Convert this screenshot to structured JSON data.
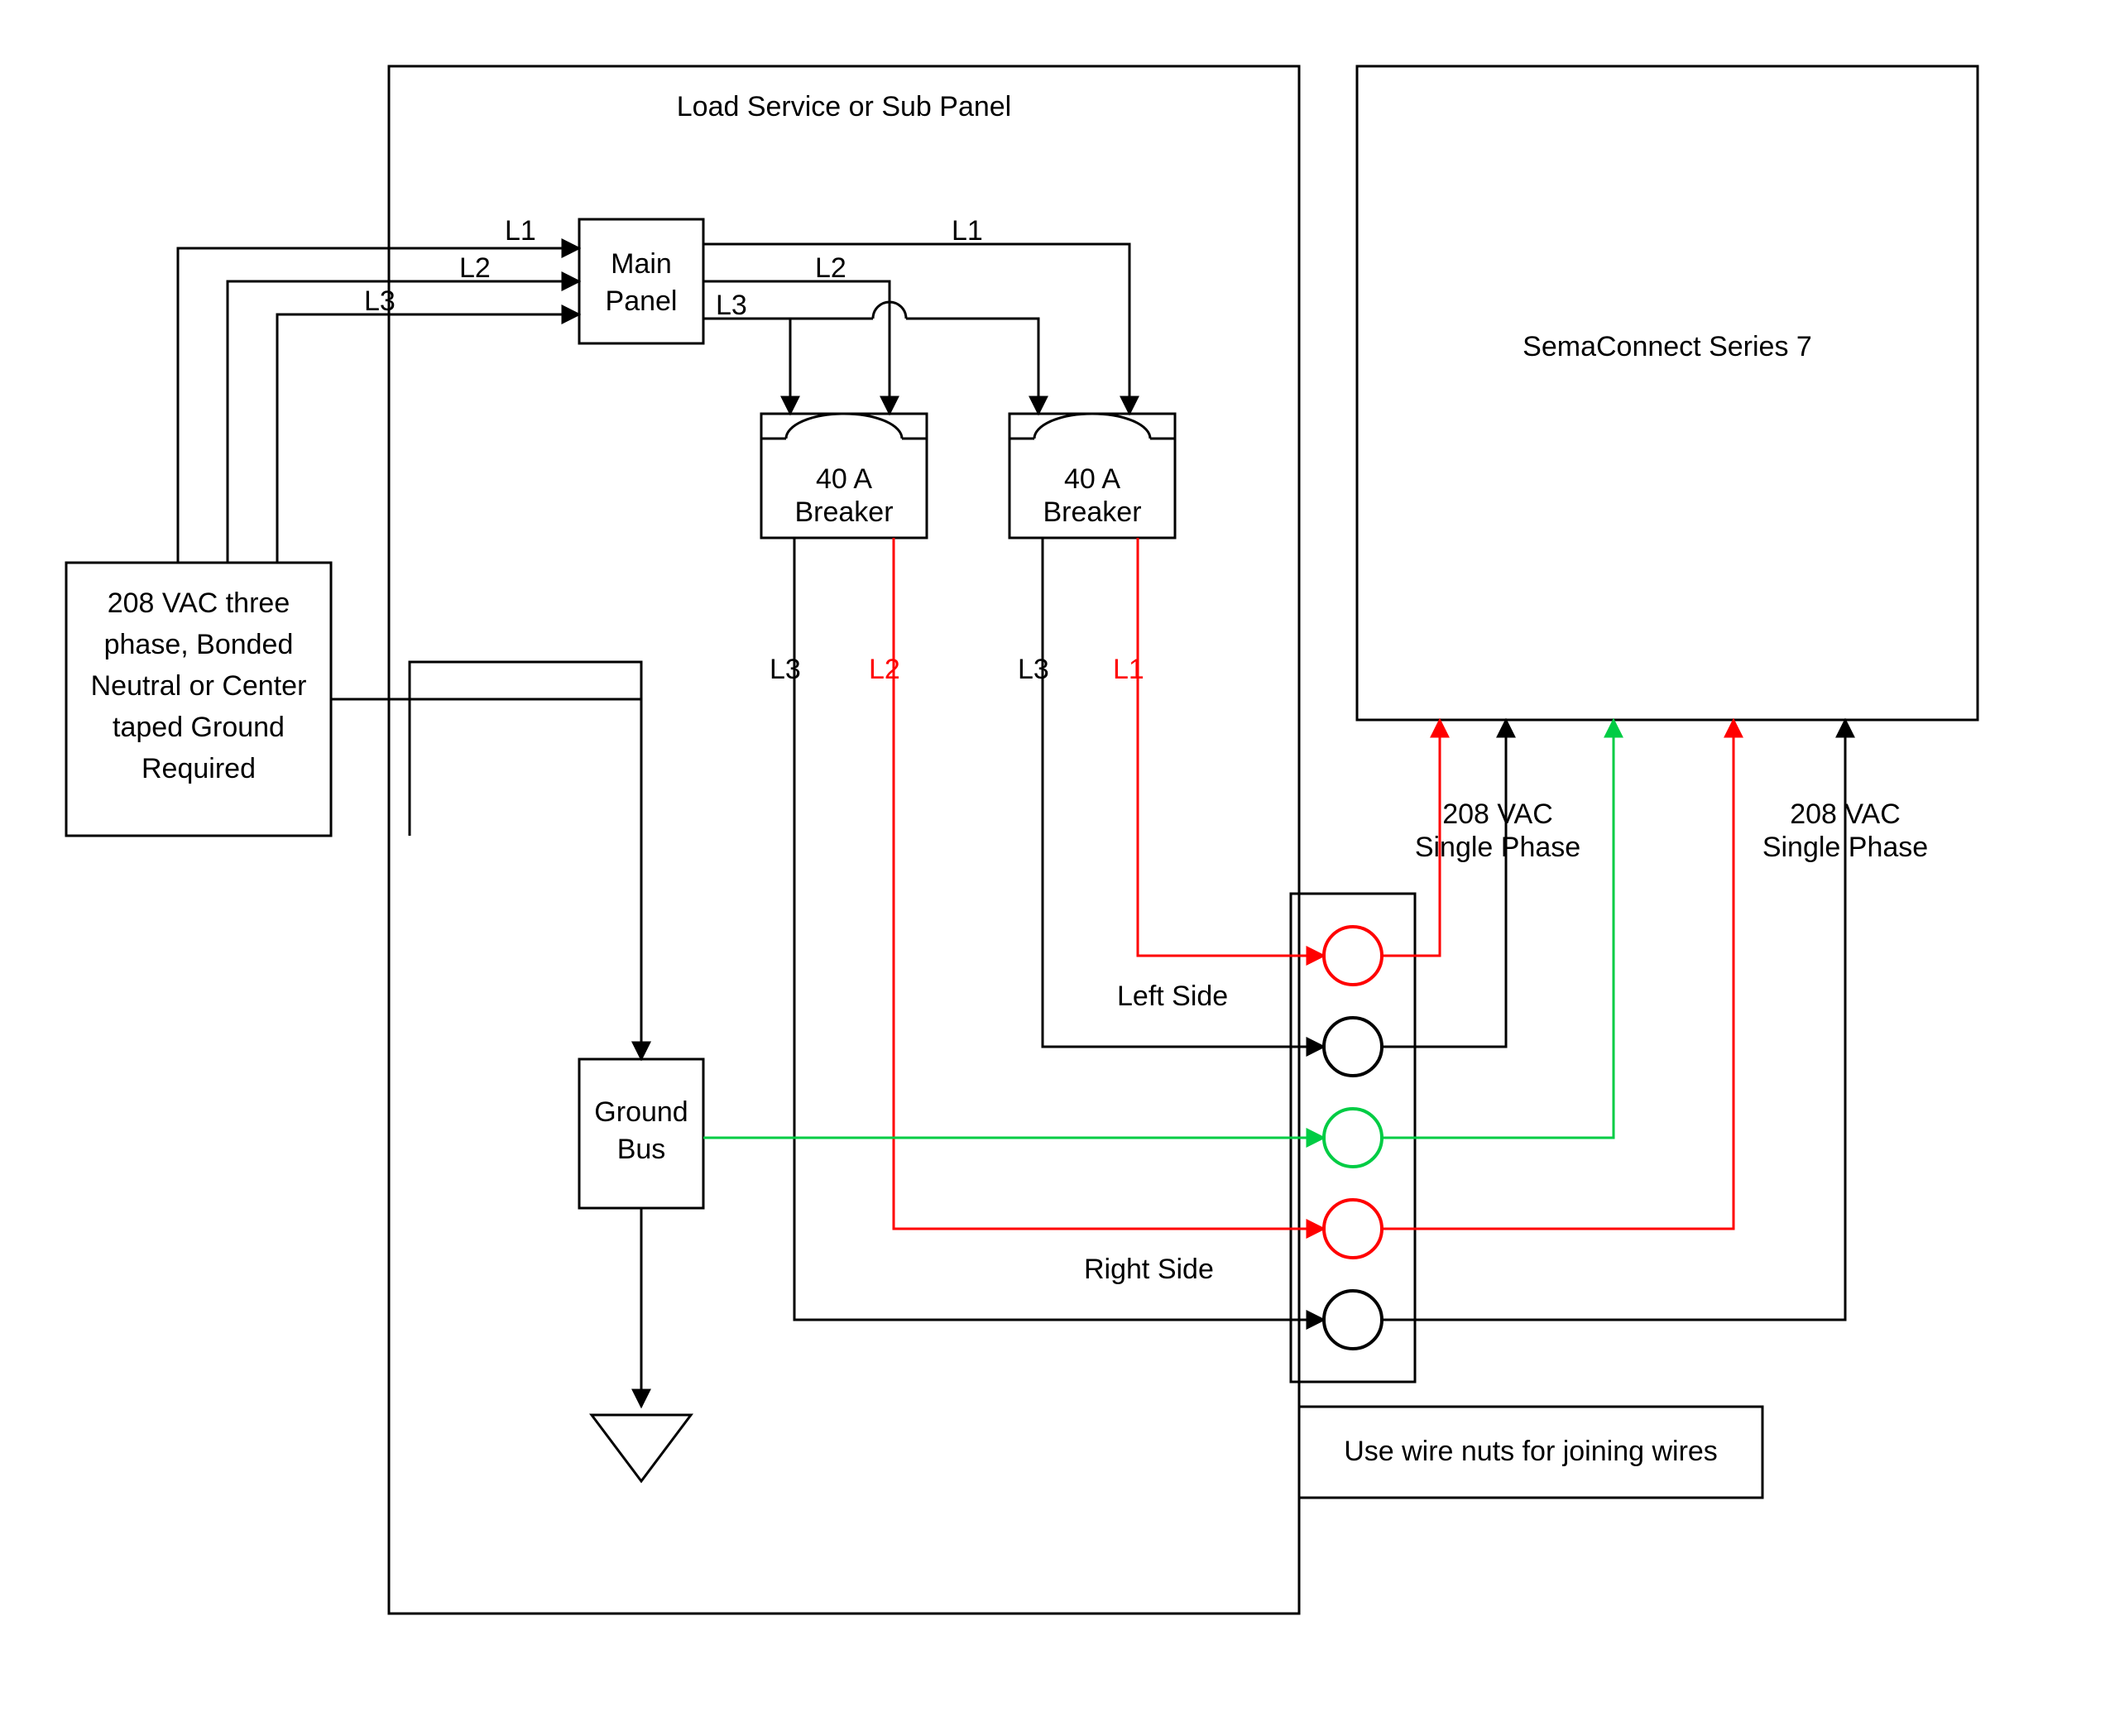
{
  "diagram": {
    "panel_title": "Load Service or Sub Panel",
    "source_box": {
      "l1": "208 VAC three",
      "l2": "phase, Bonded",
      "l3": "Neutral or Center",
      "l4": "taped Ground",
      "l5": "Required"
    },
    "main_panel": {
      "l1": "Main",
      "l2": "Panel"
    },
    "phases": {
      "l1": "L1",
      "l2": "L2",
      "l3": "L3"
    },
    "breaker1": {
      "l1": "40 A",
      "l2": "Breaker"
    },
    "breaker2": {
      "l1": "40 A",
      "l2": "Breaker"
    },
    "breaker1_out": {
      "left": "L3",
      "right": "L2"
    },
    "breaker2_out": {
      "left": "L3",
      "right": "L1"
    },
    "ground_bus": {
      "l1": "Ground",
      "l2": "Bus"
    },
    "left_side": "Left Side",
    "right_side": "Right Side",
    "phase_label1": {
      "l1": "208 VAC",
      "l2": "Single Phase"
    },
    "phase_label2": {
      "l1": "208 VAC",
      "l2": "Single Phase"
    },
    "device_box": "SemaConnect Series 7",
    "note_box": "Use wire nuts for joining wires",
    "colors": {
      "black": "#000000",
      "red": "#ff0000",
      "green": "#00cc44"
    }
  }
}
